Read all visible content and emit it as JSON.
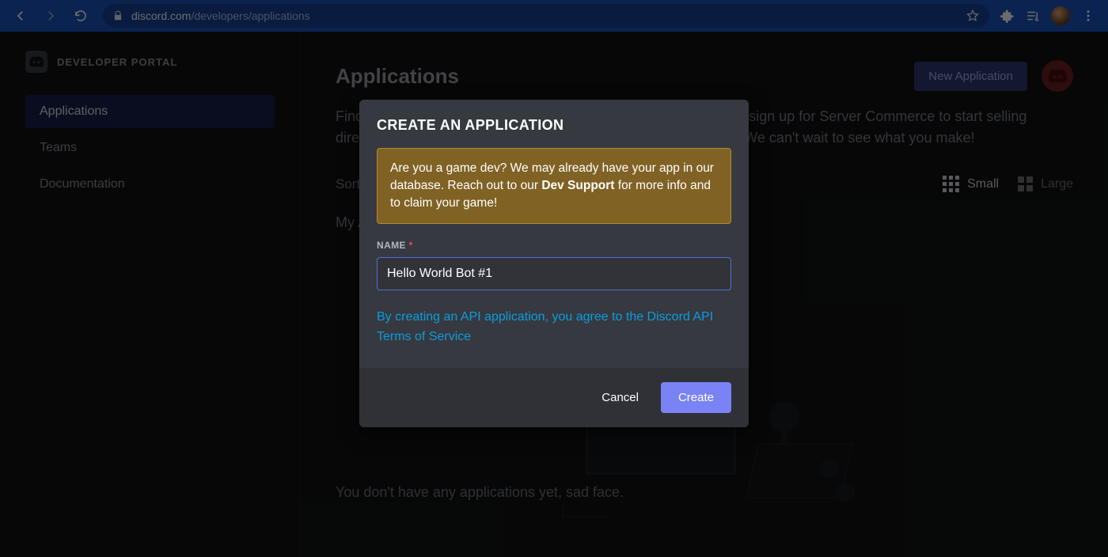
{
  "browser": {
    "url_domain": "discord.com",
    "url_path": "/developers/applications"
  },
  "sidebar": {
    "title": "DEVELOPER PORTAL",
    "items": [
      {
        "label": "Applications",
        "active": true
      },
      {
        "label": "Teams",
        "active": false
      },
      {
        "label": "Documentation",
        "active": false
      }
    ]
  },
  "main": {
    "title": "Applications",
    "new_app_button": "New Application",
    "description": "Find the perfect feature set for your game in our Game SDK, and sign up for Server Commerce to start selling directly in your server. Get started by creating a new application. We can't wait to see what you make!",
    "sort_label": "Sort By",
    "view_small": "Small",
    "view_large": "Large",
    "my_apps_label": "My Applications",
    "empty_message": "You don't have any applications yet, sad face."
  },
  "modal": {
    "title": "CREATE AN APPLICATION",
    "notice_pre": "Are you a game dev? We may already have your app in our database. Reach out to our ",
    "notice_bold": "Dev Support",
    "notice_post": " for more info and to claim your game!",
    "name_label": "NAME",
    "name_value": "Hello World Bot #1",
    "tos_text": "By creating an API application, you agree to the Discord API Terms of Service",
    "cancel": "Cancel",
    "create": "Create"
  }
}
